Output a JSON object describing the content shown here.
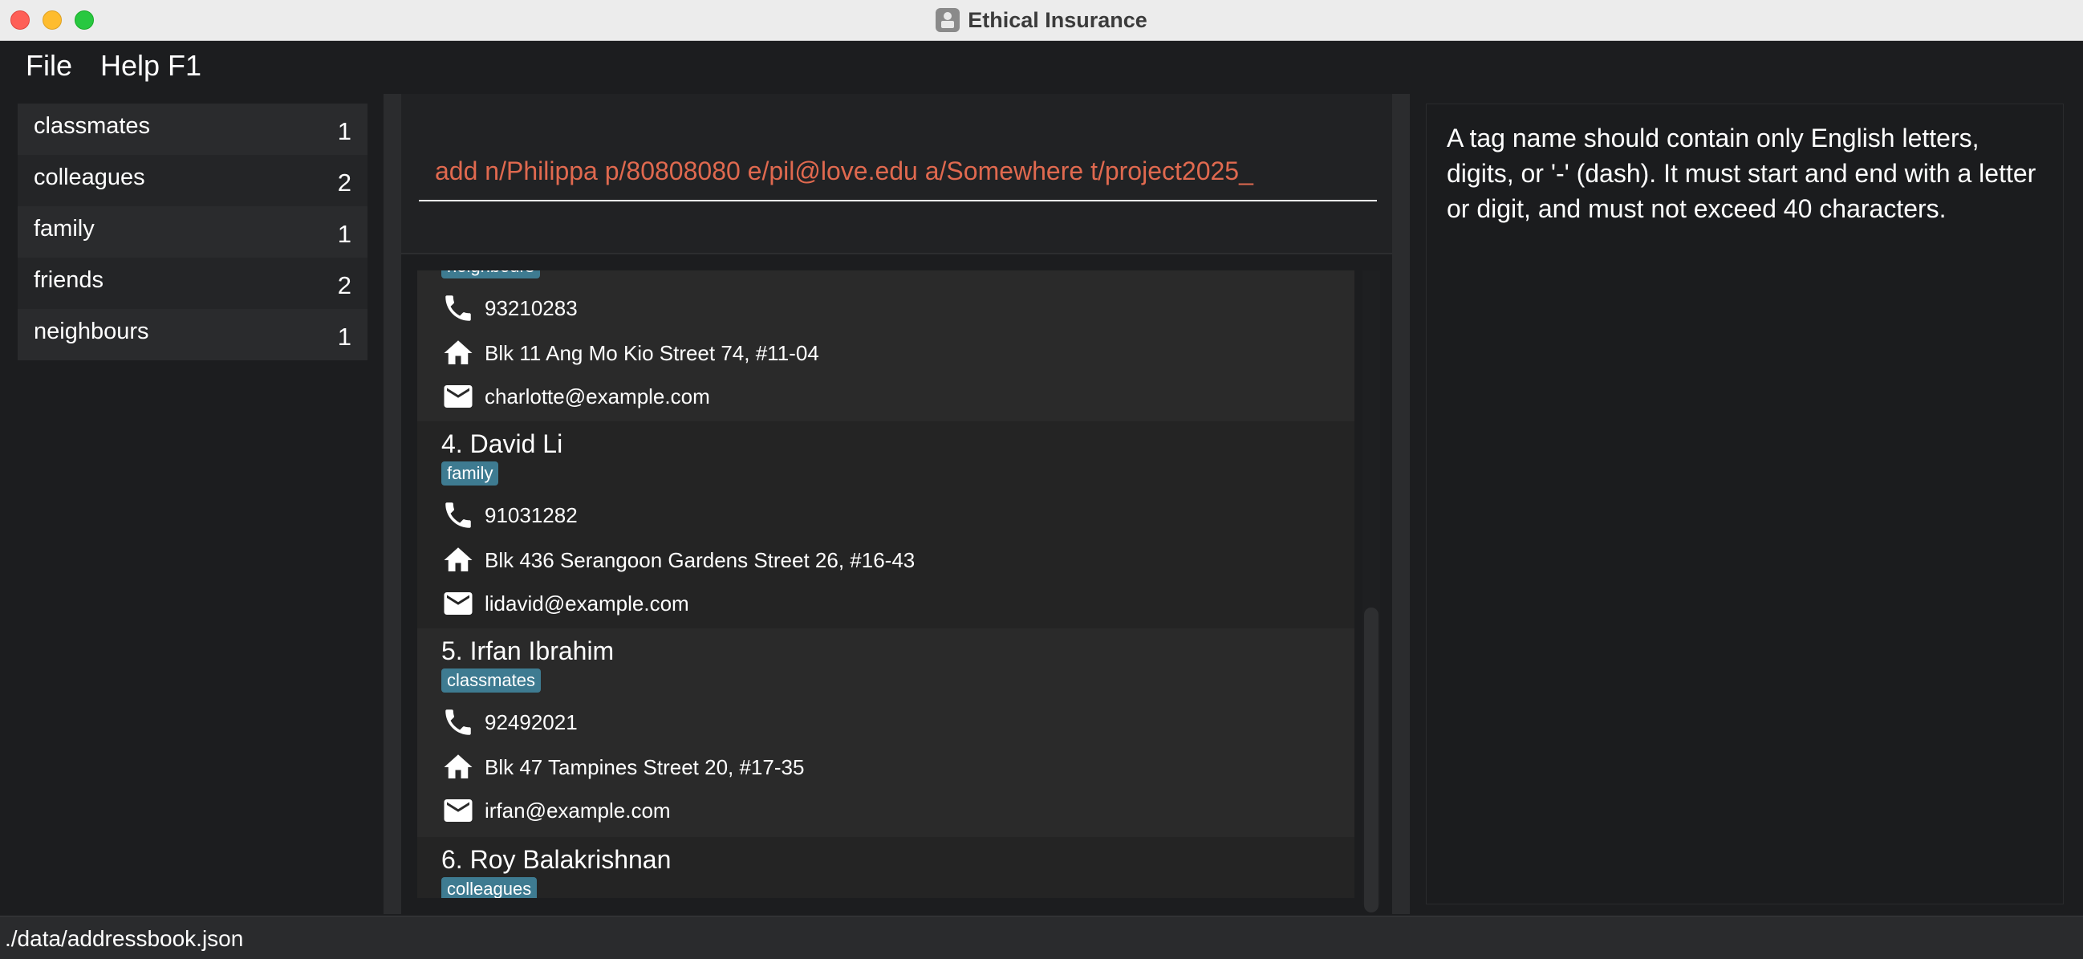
{
  "window": {
    "title": "Ethical Insurance"
  },
  "menu": {
    "file": "File",
    "help": "Help F1"
  },
  "tags": [
    {
      "name": "classmates",
      "count": "1"
    },
    {
      "name": "colleagues",
      "count": "2"
    },
    {
      "name": "family",
      "count": "1"
    },
    {
      "name": "friends",
      "count": "2"
    },
    {
      "name": "neighbours",
      "count": "1"
    }
  ],
  "command": {
    "value": "add n/Philippa p/80808080 e/pil@love.edu a/Somewhere t/project2025_"
  },
  "result": {
    "text": "A tag name should contain only English letters, digits, or '-' (dash). It must start and end with a letter or digit, and must not exceed 40 characters."
  },
  "persons": [
    {
      "name": "",
      "tag": "neighbours",
      "phone": "93210283",
      "address": "Blk 11 Ang Mo Kio Street 74, #11-04",
      "email": "charlotte@example.com"
    },
    {
      "name": "4. David Li",
      "tag": "family",
      "phone": "91031282",
      "address": "Blk 436 Serangoon Gardens Street 26, #16-43",
      "email": "lidavid@example.com"
    },
    {
      "name": "5. Irfan Ibrahim",
      "tag": "classmates",
      "phone": "92492021",
      "address": "Blk 47 Tampines Street 20, #17-35",
      "email": "irfan@example.com"
    },
    {
      "name": "6. Roy Balakrishnan",
      "tag": "colleagues"
    }
  ],
  "status": {
    "path": "./data/addressbook.json"
  },
  "icons": {
    "phone": "phone-icon",
    "address": "home-icon",
    "email": "email-icon",
    "app": "app-icon"
  },
  "colors": {
    "command_text": "#e0694f",
    "tag_badge": "#3e7b91"
  }
}
